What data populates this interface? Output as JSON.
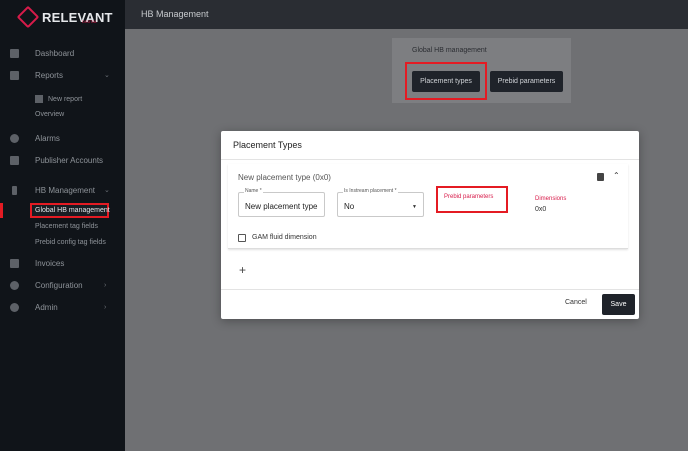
{
  "brand": {
    "name": "RELEVANT",
    "sub": "DIGITAL"
  },
  "header": {
    "title": "HB Management"
  },
  "sidebar": {
    "items": [
      {
        "label": "Dashboard"
      },
      {
        "label": "Reports"
      },
      {
        "label": "Alarms"
      },
      {
        "label": "Publisher Accounts"
      },
      {
        "label": "HB Management"
      },
      {
        "label": "Invoices"
      },
      {
        "label": "Configuration"
      },
      {
        "label": "Admin"
      }
    ],
    "reports_sub": {
      "new_report": "New report",
      "overview": "Overview"
    },
    "hb_sub": {
      "global": "Global HB management",
      "placement_tag": "Placement tag fields",
      "prebid_config": "Prebid config tag fields"
    }
  },
  "hb_card": {
    "title": "Global HB management",
    "placement_types_btn": "Placement types",
    "prebid_params_btn": "Prebid parameters"
  },
  "modal": {
    "title": "Placement Types",
    "panel": {
      "title": "New placement type (0x0)",
      "name_field": {
        "label": "Name *",
        "value": "New placement type"
      },
      "instream_field": {
        "label": "Is Instream placement *",
        "value": "No"
      },
      "prebid_link": "Prebid parameters",
      "dimensions_label": "Dimensions",
      "dimensions_value": "0x0",
      "gam_checkbox": "GAM fluid dimension"
    },
    "cancel_label": "Cancel",
    "save_label": "Save"
  },
  "colors": {
    "accent": "#d81b4a",
    "highlight": "#e41b23",
    "dark": "#1f232a"
  }
}
